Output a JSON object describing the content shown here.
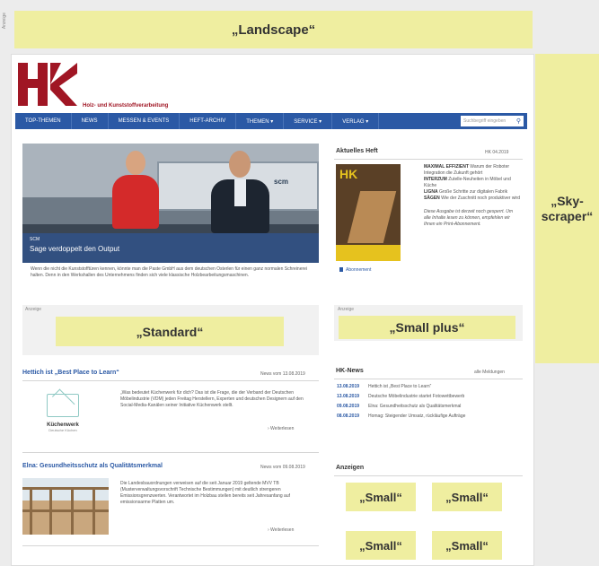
{
  "ad_label": "Anzeige",
  "ads": {
    "landscape": "„Landscape“",
    "skyscraper_1": "„Sky-",
    "skyscraper_2": "scraper“",
    "standard": "„Standard“",
    "small_plus": "„Small plus“",
    "small": "„Small“"
  },
  "logo": {
    "mark": "HK",
    "tagline": "Holz- und Kunststoffverarbeitung",
    "color": "#a01624"
  },
  "nav": {
    "items": [
      "TOP-THEMEN",
      "NEWS",
      "MESSEN & EVENTS",
      "HEFT-ARCHIV",
      "THEMEN ▾",
      "SERVICE ▾",
      "VERLAG ▾"
    ],
    "search_placeholder": "Suchbegriff eingeben",
    "color": "#2b59a5"
  },
  "hero": {
    "logo": "scm",
    "kicker": "SCM",
    "title": "Sage verdoppelt den Output",
    "intro": "Wenn die nicht die Kunststofftüren kennen, könnte man die Paste GmbH aus dem deutschen Osterlen für einen ganz normalen Schreinerei halten. Denn in den Werkshallen des Unternehmens finden sich viele klassische Holzbearbeitungsmaschinen."
  },
  "articles": [
    {
      "title": "Hettich ist „Best Place to Learn“",
      "date": "News vom 13.08.2019",
      "text": "„Was bedeutet Küchenwerk für dich? Das ist die Frage, die der Verband der Deutschen Möbelindustrie (VDM) jeden Freitag Herstellern, Experten und deutschen Designern auf den Social-Media-Kanälen seiner Initiative Küchenwerk stellt.",
      "more": "› Weiterlesen",
      "logo_name": "Küchenwerk",
      "logo_sub": "Deutsche Küchen"
    },
    {
      "title": "Elna: Gesundheitsschutz als Qualitätsmerkmal",
      "date": "News vom 09.08.2019",
      "text": "Die Landesbauordnungen verweisen auf die seit Januar 2019 geltende MVV TB (Musterverwaltungsvorschrift Technische Bestimmungen) mit deutlich strengeren Emissionsgrenzwerten. Verantwortet im Holzbau stellen bereits seit Jahresanfang auf emissionsarme Platten um.",
      "more": "› Weiterlesen"
    }
  ],
  "aktuelles_heft": {
    "title": "Aktuelles Heft",
    "date": "HK 04.2019",
    "cover_mark": "HK",
    "subscribe": "Abonnement",
    "toc": [
      {
        "bold": "MAXIMAL EFFIZIENT",
        "text": "Warum der Roboter Integration die Zukunft gehört"
      },
      {
        "bold": "INTERZUM",
        "text": "Zutelle-Neuheiten in Möbel und Küche"
      },
      {
        "bold": "LIGNA",
        "text": "Große Schritte zur digitalen Fabrik"
      },
      {
        "bold": "SÄGEN",
        "text": "Wie der Zuschnitt noch produktiver wird"
      }
    ],
    "teaser": "Diese Ausgabe ist derzeit noch gesperrt. Um alle Inhalte lesen zu können, empfehlen wir Ihnen ein Print-Abonnement."
  },
  "hk_news": {
    "title": "HK-News",
    "all": "alle Meldungen",
    "items": [
      {
        "date": "13.08.2019",
        "text": "Hettich ist „Best Place to Learn“"
      },
      {
        "date": "13.08.2019",
        "text": "Deutsche Möbelindustrie startet Fotowettbewerb"
      },
      {
        "date": "09.08.2019",
        "text": "Elna: Gesundheitsschutz als Qualitätsmerkmal"
      },
      {
        "date": "08.08.2019",
        "text": "Homag: Steigender Umsatz, rückläufige Aufträge"
      }
    ]
  },
  "anzeigen_title": "Anzeigen"
}
